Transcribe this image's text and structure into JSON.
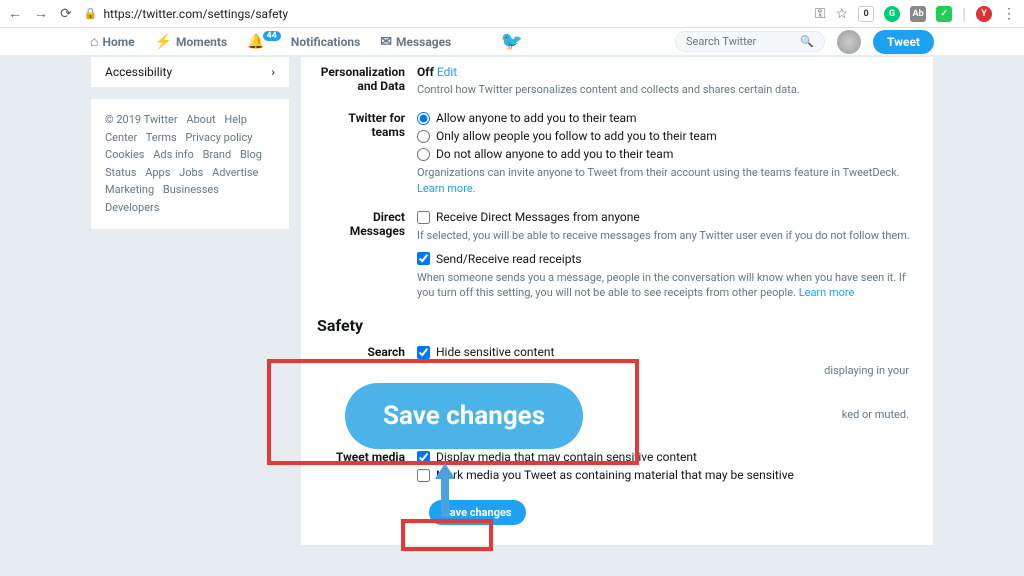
{
  "browser": {
    "url": "https://twitter.com/settings/safety"
  },
  "nav": {
    "home": "Home",
    "moments": "Moments",
    "notifications": "Notifications",
    "notif_badge": "44",
    "messages": "Messages",
    "search_placeholder": "Search Twitter",
    "tweet": "Tweet"
  },
  "sidebar": {
    "item": "Accessibility",
    "footer": {
      "copyright": "© 2019 Twitter",
      "links": [
        "About",
        "Help Center",
        "Terms",
        "Privacy policy",
        "Cookies",
        "Ads info",
        "Brand",
        "Blog",
        "Status",
        "Apps",
        "Jobs",
        "Advertise",
        "Marketing",
        "Businesses",
        "Developers"
      ]
    }
  },
  "settings": {
    "personalization": {
      "label": "Personalization and Data",
      "value": "Off",
      "edit": "Edit",
      "help": "Control how Twitter personalizes content and collects and shares certain data."
    },
    "teams": {
      "label": "Twitter for teams",
      "opt1": "Allow anyone to add you to their team",
      "opt2": "Only allow people you follow to add you to their team",
      "opt3": "Do not allow anyone to add you to their team",
      "help": "Organizations can invite anyone to Tweet from their account using the teams feature in TweetDeck.",
      "learn": "Learn more."
    },
    "dm": {
      "label": "Direct Messages",
      "opt1": "Receive Direct Messages from anyone",
      "help1": "If selected, you will be able to receive messages from any Twitter user even if you do not follow them.",
      "opt2": "Send/Receive read receipts",
      "help2": "When someone sends you a message, people in the conversation will know when you have seen it. If you turn off this setting, you will not be able to see receipts from other people.",
      "learn": "Learn more"
    },
    "safety": {
      "head": "Safety",
      "search_label": "Search",
      "search_opt": "Hide sensitive content",
      "search_help1": "displaying in your",
      "search_help2": "ked or muted.",
      "media_label": "Tweet media",
      "media_opt1": "Display media that may contain sensitive content",
      "media_opt2": "Mark media you Tweet as containing material that may be sensitive",
      "save": "Save changes"
    }
  },
  "annotation": {
    "big_save": "Save changes"
  }
}
